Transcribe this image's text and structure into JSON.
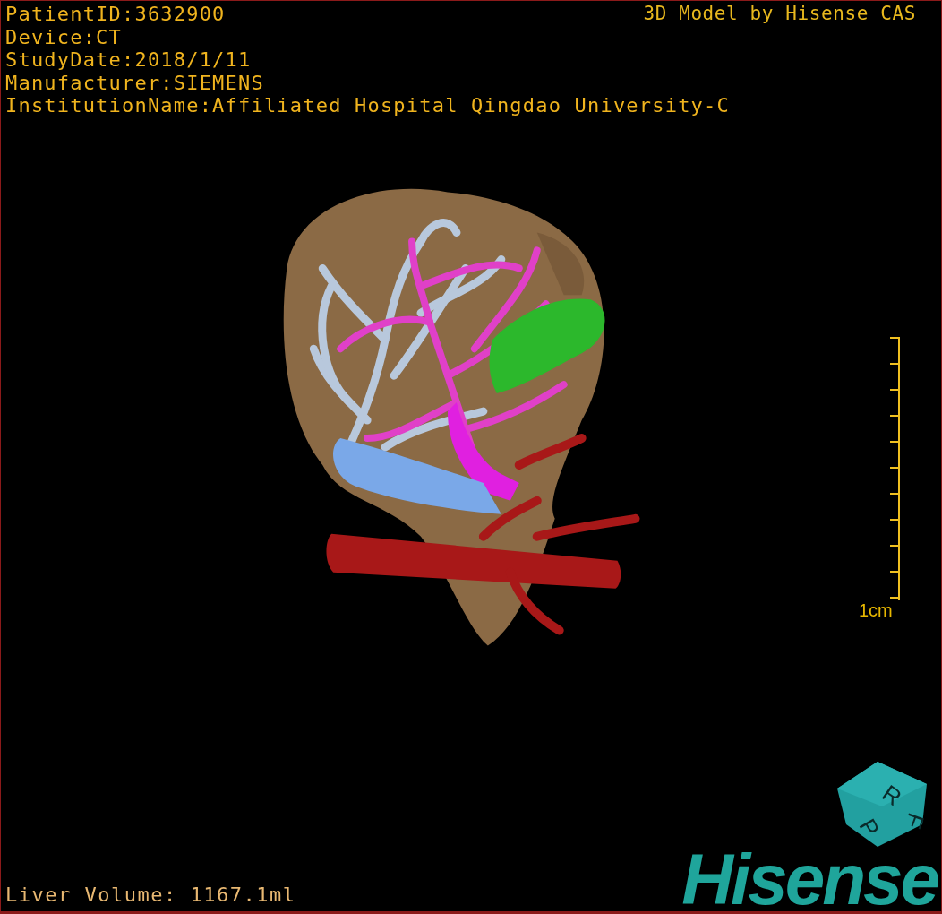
{
  "info_lines": [
    "PatientID:3632900",
    "Device:CT",
    "StudyDate:2018/1/11",
    "Manufacturer:SIEMENS",
    "InstitutionName:Affiliated Hospital Qingdao University-C"
  ],
  "credit": "3D Model by Hisense CAS",
  "scale_bar": {
    "label": "1cm"
  },
  "volume": "Liver Volume: 1167.1ml",
  "orientation_cube": {
    "faces": [
      "P",
      "R",
      "F"
    ]
  },
  "logo": "Hisense"
}
